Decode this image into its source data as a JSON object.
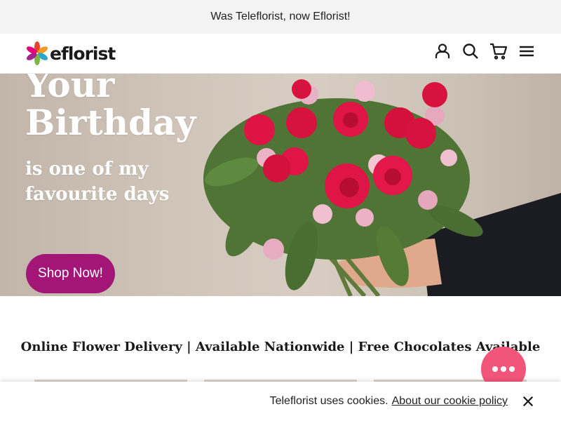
{
  "announcement": {
    "text": "Was Teleflorist, now Eflorist!"
  },
  "header": {
    "logo_text": "eflorist",
    "icons": [
      "account-icon",
      "search-icon",
      "cart-icon",
      "menu-icon"
    ]
  },
  "hero": {
    "title_line1": "Your",
    "title_line2": "Birthday",
    "subtitle_line1": "is one of my",
    "subtitle_line2": "favourite days",
    "cta_label": "Shop Now!"
  },
  "tagline": "Online Flower Delivery | Available Nationwide | Free Chocolates Available",
  "chat": {
    "icon": "chat-dots-icon"
  },
  "cookie_bar": {
    "text": "Teleflorist uses cookies.",
    "link_text": "About our cookie policy",
    "close_icon": "close-icon"
  },
  "colors": {
    "accent": "#a31677",
    "chat": "#f2557a",
    "announcement_bg": "#f3f3f3"
  }
}
